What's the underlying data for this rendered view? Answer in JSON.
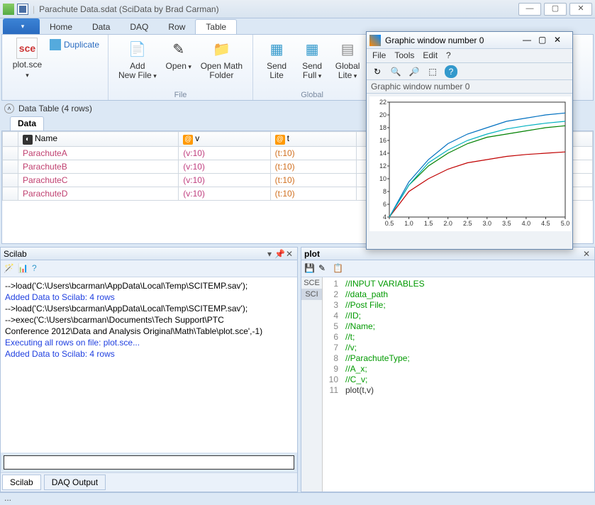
{
  "title": "Parachute Data.sdat (SciData by Brad Carman)",
  "tabs": {
    "file": "",
    "home": "Home",
    "data": "Data",
    "daq": "DAQ",
    "row": "Row",
    "table": "Table"
  },
  "ribbon": {
    "file_group": "File",
    "global_group": "Global",
    "plotsce": "plot.sce",
    "duplicate": "Duplicate",
    "addnew": "Add\nNew File",
    "open": "Open",
    "openmath": "Open Math\nFolder",
    "sendlite": "Send\nLite",
    "sendfull": "Send\nFull",
    "globallite": "Global\nLite"
  },
  "datatable_header": "Data Table (4 rows)",
  "datatab": "Data",
  "columns": {
    "name": "Name",
    "v": "v",
    "t": "t"
  },
  "rows": [
    {
      "name": "ParachuteA",
      "v": "(v:10)",
      "t": "(t:10)"
    },
    {
      "name": "ParachuteB",
      "v": "(v:10)",
      "t": "(t:10)"
    },
    {
      "name": "ParachuteC",
      "v": "(v:10)",
      "t": "(t:10)"
    },
    {
      "name": "ParachuteD",
      "v": "(v:10)",
      "t": "(t:10)"
    }
  ],
  "scilab": {
    "title": "Scilab",
    "lines": [
      {
        "t": "-->load('C:\\Users\\bcarman\\AppData\\Local\\Temp\\SCITEMP.sav');",
        "c": ""
      },
      {
        "t": "Added Data to Scilab: 4 rows",
        "c": "blue"
      },
      {
        "t": "-->load('C:\\Users\\bcarman\\AppData\\Local\\Temp\\SCITEMP.sav');",
        "c": ""
      },
      {
        "t": "-->exec('C:\\Users\\bcarman\\Documents\\Tech Support\\PTC",
        "c": ""
      },
      {
        "t": "Conference 2012\\Data and Analysis Original\\Math\\Table\\plot.sce',-1)",
        "c": ""
      },
      {
        "t": "Executing all rows on file: plot.sce...",
        "c": "blue"
      },
      {
        "t": "Added Data to Scilab: 4 rows",
        "c": "blue"
      }
    ],
    "tab_scilab": "Scilab",
    "tab_daq": "DAQ Output"
  },
  "plot": {
    "title": "plot",
    "side_sce": "SCE",
    "side_sci": "SCI",
    "code": [
      {
        "n": 1,
        "t": "//INPUT VARIABLES",
        "c": "cm"
      },
      {
        "n": 2,
        "t": "//data_path",
        "c": "cm"
      },
      {
        "n": 3,
        "t": "//Post File;",
        "c": "cm"
      },
      {
        "n": 4,
        "t": "//ID;",
        "c": "cm"
      },
      {
        "n": 5,
        "t": "//Name;",
        "c": "cm"
      },
      {
        "n": 6,
        "t": "//t;",
        "c": "cm"
      },
      {
        "n": 7,
        "t": "//v;",
        "c": "cm"
      },
      {
        "n": 8,
        "t": "//ParachuteType;",
        "c": "cm"
      },
      {
        "n": 9,
        "t": "//A_x;",
        "c": "cm"
      },
      {
        "n": 10,
        "t": "//C_v;",
        "c": "cm"
      },
      {
        "n": 11,
        "t": "plot(t,v)",
        "c": "kw"
      }
    ]
  },
  "gwin": {
    "title": "Graphic window number 0",
    "menu": {
      "file": "File",
      "tools": "Tools",
      "edit": "Edit",
      "help": "?"
    },
    "info": "Graphic window number 0"
  },
  "status": "...",
  "chart_data": {
    "type": "line",
    "x": [
      0.5,
      1.0,
      1.5,
      2.0,
      2.5,
      3.0,
      3.5,
      4.0,
      4.5,
      5.0
    ],
    "series": [
      {
        "name": "ParachuteA",
        "color": "#c00000",
        "values": [
          4,
          8,
          10,
          11.5,
          12.5,
          13,
          13.5,
          13.8,
          14,
          14.2
        ]
      },
      {
        "name": "ParachuteB",
        "color": "#008000",
        "values": [
          4,
          9,
          12,
          14,
          15.5,
          16.5,
          17,
          17.5,
          18,
          18.3
        ]
      },
      {
        "name": "ParachuteC",
        "color": "#0070c0",
        "values": [
          4,
          9.5,
          13,
          15.5,
          17,
          18,
          19,
          19.5,
          20,
          20.3
        ]
      },
      {
        "name": "ParachuteD",
        "color": "#00b0c0",
        "values": [
          4,
          9,
          12.5,
          14.5,
          16,
          17,
          17.8,
          18.3,
          18.7,
          19
        ]
      }
    ],
    "xlim": [
      0.5,
      5.0
    ],
    "ylim": [
      4,
      22
    ],
    "xticks": [
      0.5,
      1.0,
      1.5,
      2.0,
      2.5,
      3.0,
      3.5,
      4.0,
      4.5,
      5.0
    ],
    "yticks": [
      4,
      6,
      8,
      10,
      12,
      14,
      16,
      18,
      20,
      22
    ]
  }
}
